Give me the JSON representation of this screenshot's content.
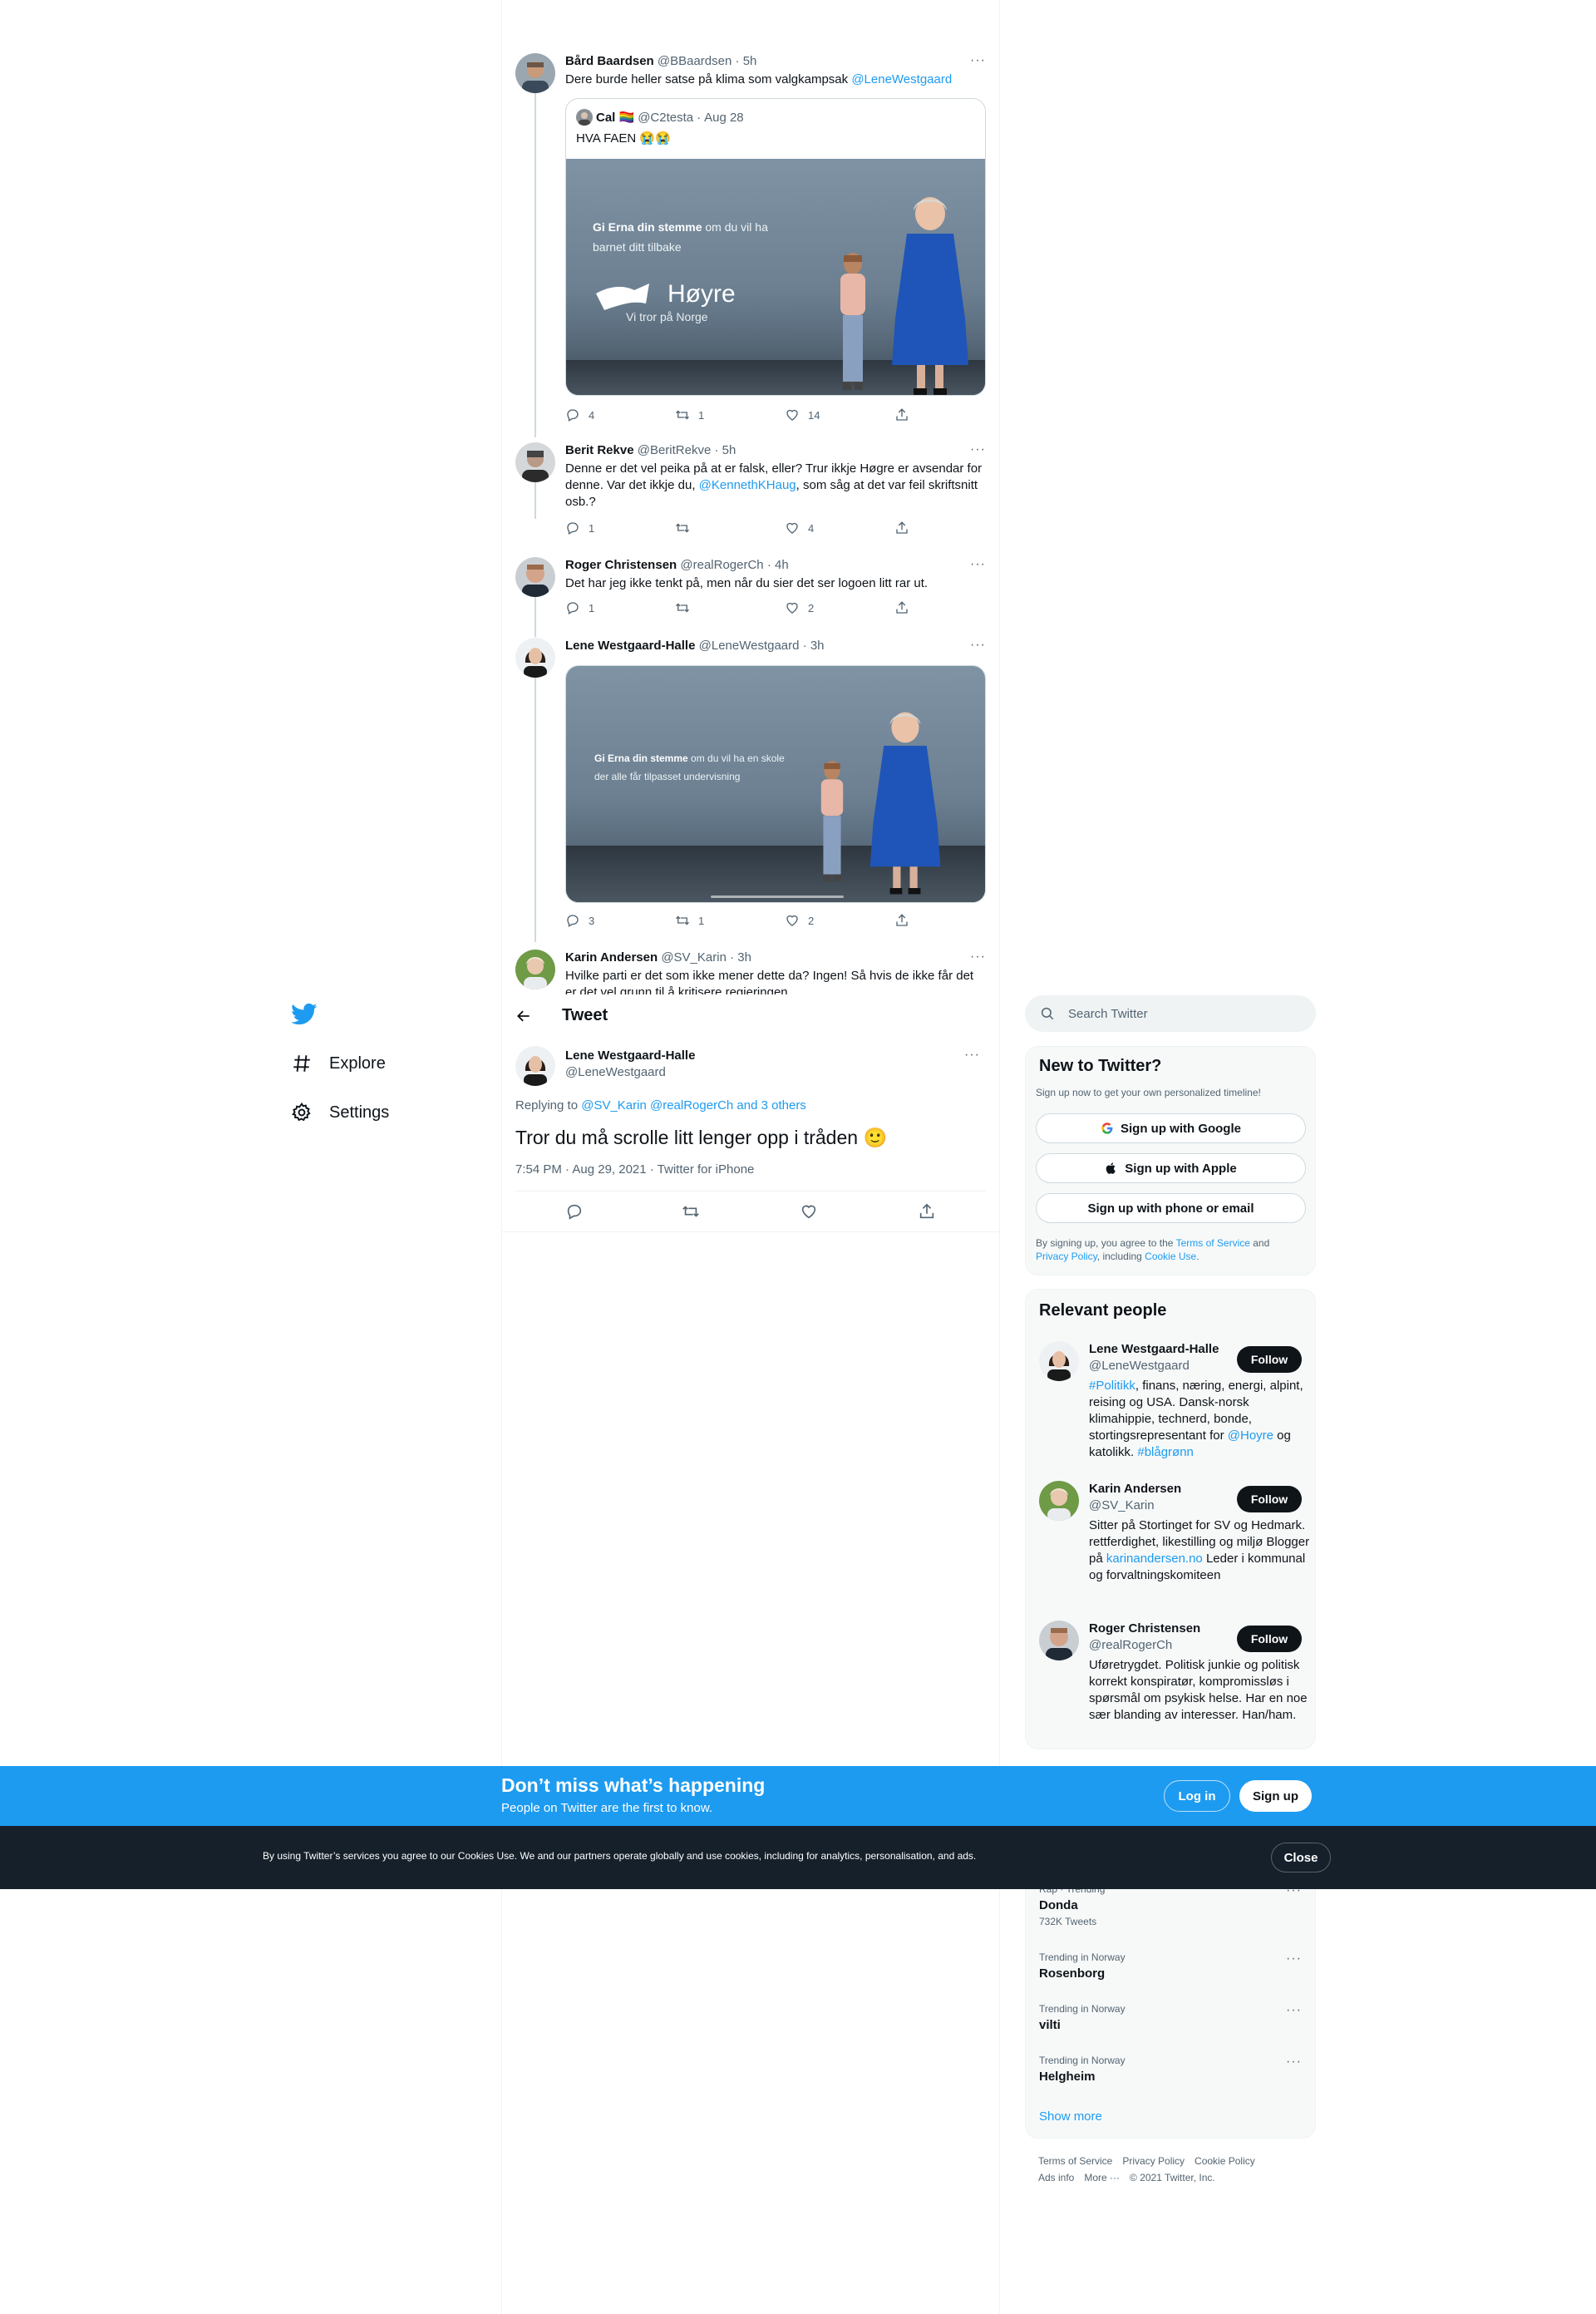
{
  "thread": {
    "tweets": [
      {
        "name": "Bård Baardsen",
        "handle": "@BBaardsen",
        "time": "5h",
        "text_prefix": "Dere burde heller satse på klima som valgkampsak ",
        "mention": "@LeneWestgaard",
        "quote": {
          "name": "Cal 🏳️‍🌈",
          "handle": "@C2testa",
          "time": "Aug 28",
          "text": "HVA FAEN 😭😭",
          "image": {
            "line1_bold": "Gi Erna din stemme",
            "line1_rest": " om du vil ha",
            "line2": "barnet ditt tilbake",
            "logo": "Høyre",
            "tagline": "Vi tror på Norge"
          }
        },
        "replies": "4",
        "retweets": "1",
        "likes": "14"
      },
      {
        "name": "Berit Rekve",
        "handle": "@BeritRekve",
        "time": "5h",
        "text_a": "Denne er det vel peika på at er falsk, eller? Trur ikkje Høgre er avsendar for denne. Var det ikkje du, ",
        "mention": "@KennethKHaug",
        "text_b": ", som såg at det var feil skriftsnitt osb.?",
        "replies": "1",
        "retweets": "",
        "likes": "4"
      },
      {
        "name": "Roger Christensen",
        "handle": "@realRogerCh",
        "time": "4h",
        "text": "Det har jeg ikke tenkt på, men når du sier det ser logoen litt rar ut.",
        "replies": "1",
        "retweets": "",
        "likes": "2"
      },
      {
        "name": "Lene Westgaard-Halle",
        "handle": "@LeneWestgaard",
        "time": "3h",
        "image": {
          "line1_bold": "Gi Erna din stemme",
          "line1_rest": " om du vil ha en skole",
          "line2": "der alle får tilpasset undervisning"
        },
        "replies": "3",
        "retweets": "1",
        "likes": "2"
      },
      {
        "name": "Karin Andersen",
        "handle": "@SV_Karin",
        "time": "3h",
        "text": "Hvilke parti er det som ikke mener dette da? Ingen! Så hvis de ikke får det er det vel grunn til å kritisere regjeringen"
      }
    ]
  },
  "nav": {
    "explore": "Explore",
    "settings": "Settings"
  },
  "main": {
    "title": "Tweet",
    "author_name": "Lene Westgaard-Halle",
    "author_handle": "@LeneWestgaard",
    "replying_label": "Replying to ",
    "replying_to": "@SV_Karin @realRogerCh and 3 others",
    "text": "Tror du må scrolle litt lenger opp i tråden 🙂",
    "meta": "7:54 PM · Aug 29, 2021 · Twitter for iPhone"
  },
  "sidebar": {
    "search_placeholder": "Search Twitter",
    "new_title": "New to Twitter?",
    "new_sub": "Sign up now to get your own personalized timeline!",
    "google": "Sign up with Google",
    "apple": "Sign up with Apple",
    "phone": "Sign up with phone or email",
    "terms_a": "By signing up, you agree to the ",
    "terms_link": "Terms of Service",
    "terms_b": " and ",
    "privacy_link": "Privacy Policy",
    "terms_c": ", including ",
    "cookie_link": "Cookie Use",
    "terms_d": ".",
    "relevant_title": "Relevant people",
    "follow": "Follow",
    "people": [
      {
        "name": "Lene Westgaard-Halle",
        "handle": "@LeneWestgaard",
        "bio_link1": "#Politikk",
        "bio_a": ", finans, næring, energi, alpint, reising og USA. Dansk-norsk klimahippie, technerd, bonde, stortingsrepresentant for ",
        "bio_link2": "@Hoyre",
        "bio_b": " og katolikk. ",
        "bio_link3": "#blågrønn"
      },
      {
        "name": "Karin Andersen",
        "handle": "@SV_Karin",
        "bio_a": "Sitter på Stortinget for SV og Hedmark. rettferdighet, likestilling og miljø Blogger på ",
        "bio_link1": "karinandersen.no",
        "bio_b": " Leder i kommunal og forvaltningskomiteen"
      },
      {
        "name": "Roger Christensen",
        "handle": "@realRogerCh",
        "bio": "Uføretrygdet. Politisk junkie og politisk korrekt konspiratør, kompromissløs i spørsmål om psykisk helse. Har en noe sær blanding av interesser. Han/ham."
      }
    ],
    "trends": [
      {
        "category": "Rap · Trending",
        "name": "Donda",
        "count": "732K Tweets"
      },
      {
        "category": "Trending in Norway",
        "name": "Rosenborg"
      },
      {
        "category": "Trending in Norway",
        "name": "vilti"
      },
      {
        "category": "Trending in Norway",
        "name": "Helgheim"
      }
    ],
    "show_more": "Show more",
    "footer": {
      "tos": "Terms of Service",
      "privacy": "Privacy Policy",
      "cookie": "Cookie Policy",
      "ads": "Ads info",
      "more": "More ···",
      "copy": "© 2021 Twitter, Inc."
    }
  },
  "banner": {
    "title": "Don’t miss what’s happening",
    "sub": "People on Twitter are the first to know.",
    "login": "Log in",
    "signup": "Sign up"
  },
  "cookie": {
    "text": "By using Twitter’s services you agree to our Cookies Use. We and our partners operate globally and use cookies, including for analytics, personalisation, and ads.",
    "close": "Close"
  },
  "colors": {
    "accent": "#1d9bf0",
    "dark": "#0f1419",
    "cookie_bg": "#15202b"
  }
}
